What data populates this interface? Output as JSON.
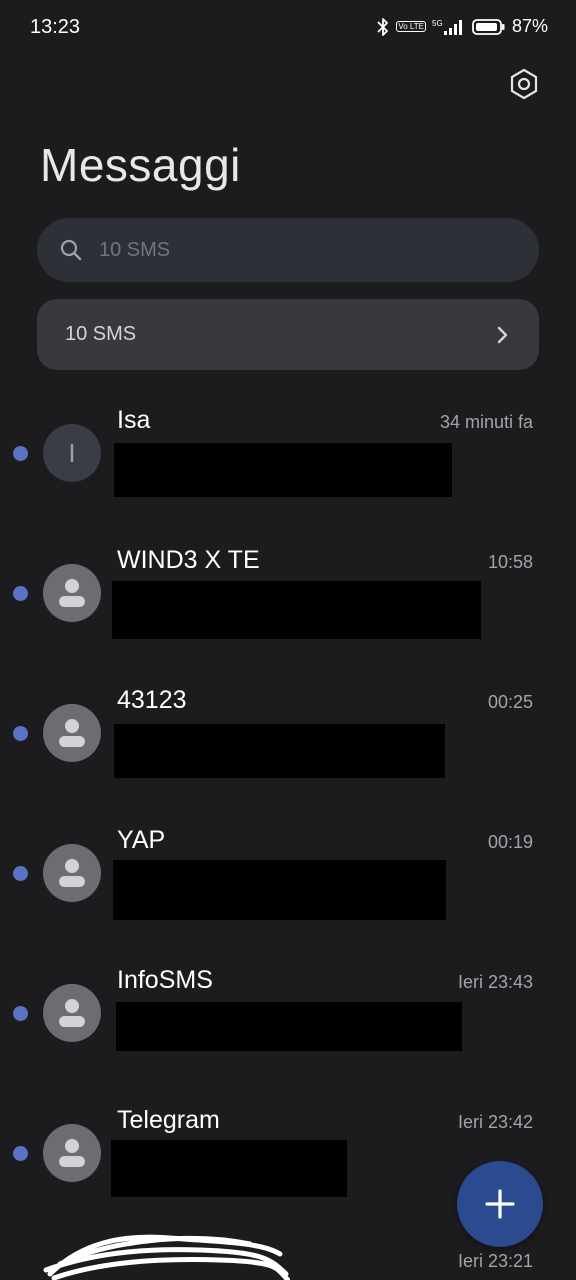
{
  "status_bar": {
    "time": "13:23",
    "network": "5G",
    "volte": "Vo LTE",
    "battery_percent": "87%"
  },
  "header": {
    "title": "Messaggi"
  },
  "search": {
    "placeholder": "10 SMS"
  },
  "sms_banner": {
    "label": "10 SMS"
  },
  "conversations": [
    {
      "name": "Isa",
      "time": "34 minuti fa",
      "avatar_letter": "I",
      "unread": true
    },
    {
      "name": "WIND3 X TE",
      "time": "10:58",
      "unread": true
    },
    {
      "name": "43123",
      "time": "00:25",
      "unread": true
    },
    {
      "name": "YAP",
      "time": "00:19",
      "unread": true
    },
    {
      "name": "InfoSMS",
      "time": "Ieri 23:43",
      "unread": true
    },
    {
      "name": "Telegram",
      "time": "Ieri 23:42",
      "unread": true
    }
  ],
  "last_partial": {
    "time": "Ieri 23:21"
  },
  "colors": {
    "background": "#1c1c1e",
    "unread_dot": "#5a72c4",
    "fab": "#2c4a8f"
  },
  "icons": [
    "bluetooth-icon",
    "signal-icon",
    "battery-icon",
    "settings-gear-icon",
    "search-icon",
    "chevron-right-icon",
    "person-icon",
    "plus-icon"
  ]
}
